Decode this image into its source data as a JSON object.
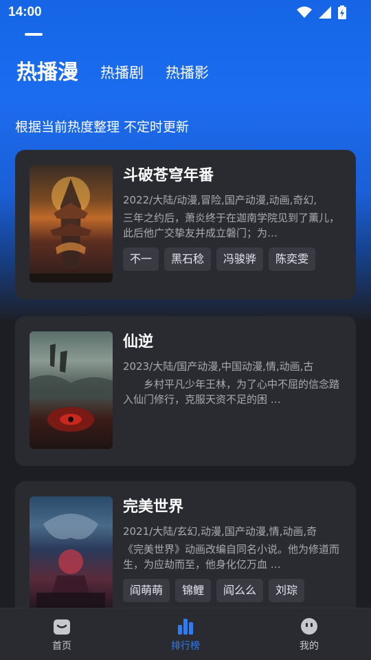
{
  "status": {
    "time": "14:00"
  },
  "tabs": [
    {
      "label": "热播漫",
      "active": true
    },
    {
      "label": "热播剧",
      "active": false
    },
    {
      "label": "热播影",
      "active": false
    }
  ],
  "subtitle": "根据当前热度整理 不定时更新",
  "cards": [
    {
      "title": "斗破苍穹年番",
      "meta": "2022/大陆/动漫,冒险,国产动漫,动画,奇幻,",
      "desc": "三年之约后，萧炎终于在迦南学院见到了薰儿，此后他广交挚友并成立磐门；为…",
      "tags": [
        "不一",
        "黑石稔",
        "冯骏骅",
        "陈奕雯"
      ]
    },
    {
      "title": "仙逆",
      "meta": "2023/大陆/国产动漫,中国动漫,情,动画,古",
      "desc": "　　乡村平凡少年王林，为了心中不屈的信念踏入仙门修行，克服天资不足的困 …",
      "tags": []
    },
    {
      "title": "完美世界",
      "meta": "2021/大陆/玄幻,动漫,国产动漫,情,动画,奇",
      "desc": "《完美世界》动画改编自同名小说。他为修道而生，为应劫而至，他身化亿万血 …",
      "tags": [
        "阎萌萌",
        "锦鲤",
        "阎么么",
        "刘琮"
      ]
    }
  ],
  "nav": [
    {
      "label": "首页",
      "icon": "home-icon",
      "active": false
    },
    {
      "label": "排行榜",
      "icon": "ranking-icon",
      "active": true
    },
    {
      "label": "我的",
      "icon": "profile-icon",
      "active": false
    }
  ],
  "colors": {
    "accent": "#2f7cf6",
    "card_bg": "#2a2b31",
    "page_bg": "#1d1e23",
    "hero_blue": "#1c6cf0"
  }
}
